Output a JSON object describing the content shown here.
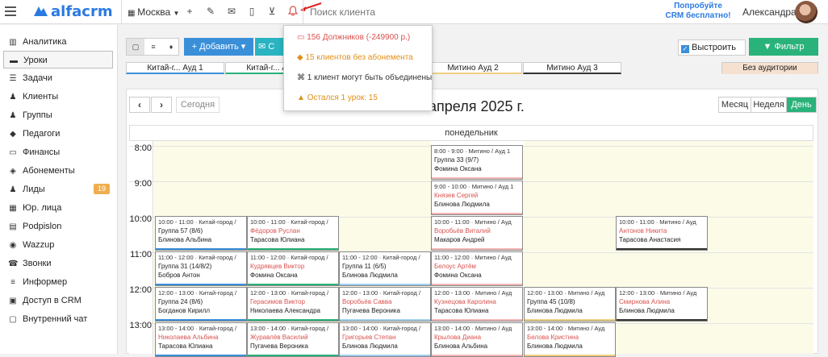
{
  "topbar": {
    "logo": "alfacrm",
    "city": "Москва",
    "search_placeholder": "Поиск клиента",
    "promo_line1": "Попробуйте",
    "promo_line2": "CRM бесплатно!",
    "user_name": "Александра"
  },
  "sidebar": {
    "items": [
      {
        "label": "Аналитика",
        "icon": "chart-icon"
      },
      {
        "label": "Уроки",
        "icon": "book-icon",
        "active": true
      },
      {
        "label": "Задачи",
        "icon": "tasks-icon"
      },
      {
        "label": "Клиенты",
        "icon": "person-icon"
      },
      {
        "label": "Группы",
        "icon": "group-icon"
      },
      {
        "label": "Педагоги",
        "icon": "graduation-cap-icon"
      },
      {
        "label": "Финансы",
        "icon": "money-icon"
      },
      {
        "label": "Абонементы",
        "icon": "tag-icon"
      },
      {
        "label": "Лиды",
        "icon": "person-icon",
        "badge": "19"
      },
      {
        "label": "Юр. лица",
        "icon": "building-icon"
      },
      {
        "label": "Podpislon",
        "icon": "doc-icon"
      },
      {
        "label": "Wazzup",
        "icon": "whatsapp-icon"
      },
      {
        "label": "Звонки",
        "icon": "phone-icon"
      },
      {
        "label": "Информер",
        "icon": "list-icon"
      },
      {
        "label": "Доступ в CRM",
        "icon": "lock-icon"
      },
      {
        "label": "Внутренний чат",
        "icon": "chat-icon"
      }
    ]
  },
  "toolbar": {
    "add_label": "+ Добавить ▾",
    "add2_label": "✉ С",
    "quick_label": "Выстроить",
    "filter_label": "▼ Фильтр"
  },
  "rooms": [
    {
      "name": "Китай-г... Ауд 1",
      "color": "#3a8fd9"
    },
    {
      "name": "Китай-г... Ауд 2",
      "color": "#2ab27b"
    },
    {
      "name": "Митино Ауд 1",
      "color": "#f4b6b6"
    },
    {
      "name": "Митино Ауд 2",
      "color": "#f0d080"
    },
    {
      "name": "Митино Ауд 3",
      "color": "#333333"
    },
    {
      "name": "Без аудитории",
      "color": "#f6e0d0"
    }
  ],
  "calendar": {
    "prev": "‹",
    "next": "›",
    "today": "Сегодня",
    "title": "7 апреля 2025 г.",
    "range_month": "Месяц",
    "range_week": "Неделя",
    "range_day": "День",
    "day_name": "понедельник",
    "hours": [
      "8:00",
      "9:00",
      "10:00",
      "11:00",
      "12:00",
      "13:00"
    ]
  },
  "notifications": {
    "debtors": "156 Должников (-249900 р.)",
    "no_subscription": "15 клиентов без абонемента",
    "merge": "1 клиент могут быть объединены",
    "one_lesson": "Остался 1 урок: 15"
  },
  "lessons": [
    {
      "time": "8:00 - 9:00 · Митино / Ауд 1",
      "group": "Группа 33 (9/7)",
      "teacher": "Фомина Оксана"
    },
    {
      "time": "9:00 - 10:00 · Митино / Ауд 1",
      "client": "Князев Сергей",
      "teacher": "Блинова Людмила"
    },
    {
      "time": "10:00 - 11:00 · Китай-город /",
      "group": "Группа 57 (8/6)",
      "teacher": "Блинова Альбина"
    },
    {
      "time": "10:00 - 11:00 · Китай-город /",
      "client": "Фёдоров Руслан",
      "teacher": "Тарасова Юлиана"
    },
    {
      "time": "10:00 - 11:00 · Митино / Ауд",
      "client": "Воробьёв Виталий",
      "teacher": "Макаров Андрей"
    },
    {
      "time": "10:00 - 11:00 · Митино / Ауд",
      "client": "Антонов Никита",
      "teacher": "Тарасова Анастасия"
    },
    {
      "time": "11:00 - 12:00 · Китай-город /",
      "group": "Группа 31 (14/8/2)",
      "teacher": "Бобров Антон"
    },
    {
      "time": "11:00 - 12:00 · Китай-город /",
      "client": "Кудрявцев Виктор",
      "teacher": "Фомина Оксана"
    },
    {
      "time": "11:00 - 12:00 · Китай-город /",
      "group": "Группа 11 (6/5)",
      "teacher": "Блинова Людмила"
    },
    {
      "time": "11:00 - 12:00 · Митино / Ауд",
      "client": "Белоус Артём",
      "teacher": "Фомина Оксана"
    },
    {
      "time": "12:00 - 13:00 · Китай-город /",
      "group": "Группа 24 (8/6)",
      "teacher": "Богданов Кирилл"
    },
    {
      "time": "12:00 - 13:00 · Китай-город /",
      "client": "Герасимов Виктор",
      "teacher": "Николаева Александра"
    },
    {
      "time": "12:00 - 13:00 · Китай-город /",
      "client": "Воробьёв Савва",
      "teacher": "Пугачева Вероника"
    },
    {
      "time": "12:00 - 13:00 · Митино / Ауд",
      "client": "Кузнецова Каролина",
      "teacher": "Тарасова Юлиана"
    },
    {
      "time": "12:00 - 13:00 · Митино / Ауд",
      "group": "Группа 45 (10/8)",
      "teacher": "Блинова Людмила"
    },
    {
      "time": "12:00 - 13:00 · Митино / Ауд",
      "client": "Смирнова Алина",
      "teacher": "Блинова Людмила"
    },
    {
      "time": "13:00 - 14:00 · Китай-город /",
      "client": "Николаева Альбина",
      "teacher": "Тарасова Юлиана"
    },
    {
      "time": "13:00 - 14:00 · Китай-город /",
      "client": "Журавлёв Василий",
      "teacher": "Пугачева Вероника"
    },
    {
      "time": "13:00 - 14:00 · Китай-город /",
      "client": "Григорьев Степан",
      "teacher": "Блинова Людмила"
    },
    {
      "time": "13:00 - 14:00 · Митино / Ауд",
      "client": "Крылова Диана",
      "teacher": "Блинова Альбина"
    },
    {
      "time": "13:00 - 14:00 · Митино / Ауд",
      "client": "Белова Кристина",
      "teacher": "Блинова Людмила"
    }
  ]
}
